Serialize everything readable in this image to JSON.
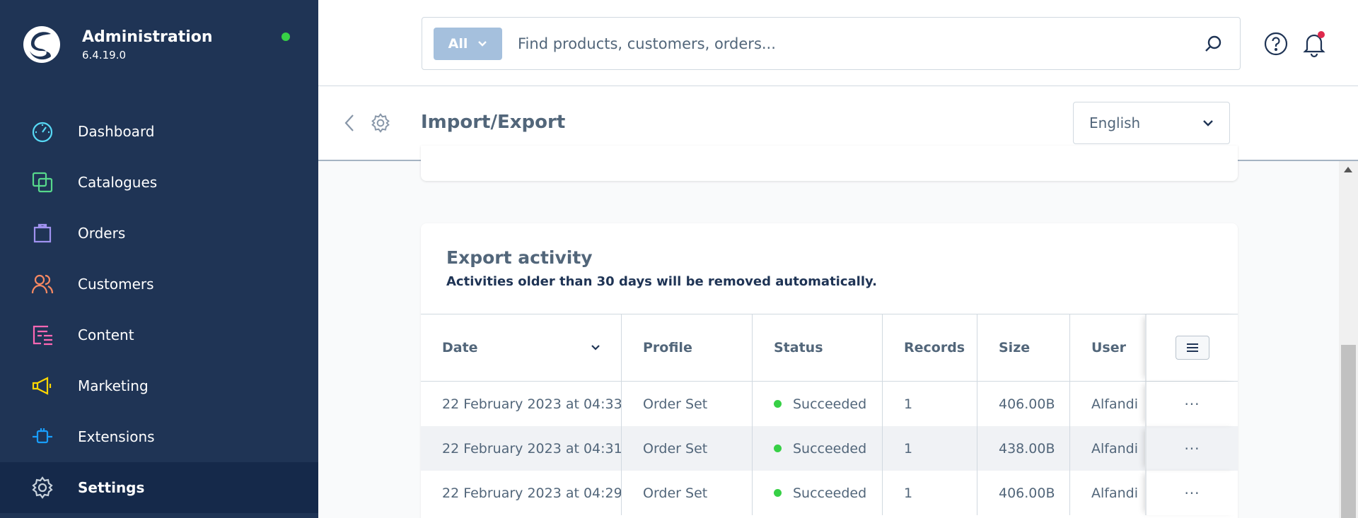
{
  "sidebar": {
    "brand_title": "Administration",
    "brand_version": "6.4.19.0",
    "items": [
      {
        "label": "Dashboard",
        "icon": "dashboard-icon",
        "color": "#57d9f5"
      },
      {
        "label": "Catalogues",
        "icon": "catalogues-icon",
        "color": "#57d98c"
      },
      {
        "label": "Orders",
        "icon": "orders-icon",
        "color": "#a092f0"
      },
      {
        "label": "Customers",
        "icon": "customers-icon",
        "color": "#f88962"
      },
      {
        "label": "Content",
        "icon": "content-icon",
        "color": "#ff68b4"
      },
      {
        "label": "Marketing",
        "icon": "marketing-icon",
        "color": "#ffd700"
      },
      {
        "label": "Extensions",
        "icon": "extensions-icon",
        "color": "#189eff"
      },
      {
        "label": "Settings",
        "icon": "settings-icon",
        "color": "#ffffff",
        "active": true
      }
    ]
  },
  "search": {
    "type_label": "All",
    "placeholder": "Find products, customers, orders..."
  },
  "header": {
    "title": "Import/Export",
    "language": "English"
  },
  "export_activity": {
    "title": "Export activity",
    "subtitle": "Activities older than 30 days will be removed automatically.",
    "columns": [
      "Date",
      "Profile",
      "Status",
      "Records",
      "Size",
      "User"
    ],
    "rows": [
      {
        "date": "22 February 2023 at 04:33",
        "profile": "Order Set",
        "status": "Succeeded",
        "records": "1",
        "size": "406.00B",
        "user": "Alfandi"
      },
      {
        "date": "22 February 2023 at 04:31",
        "profile": "Order Set",
        "status": "Succeeded",
        "records": "1",
        "size": "438.00B",
        "user": "Alfandi"
      },
      {
        "date": "22 February 2023 at 04:29",
        "profile": "Order Set",
        "status": "Succeeded",
        "records": "1",
        "size": "406.00B",
        "user": "Alfandi"
      }
    ],
    "action_label": "···"
  },
  "colors": {
    "sidebar_bg": "#1f3455",
    "sidebar_active": "#15294a",
    "status_success": "#37d046",
    "search_type_bg": "#a5c0dd"
  }
}
